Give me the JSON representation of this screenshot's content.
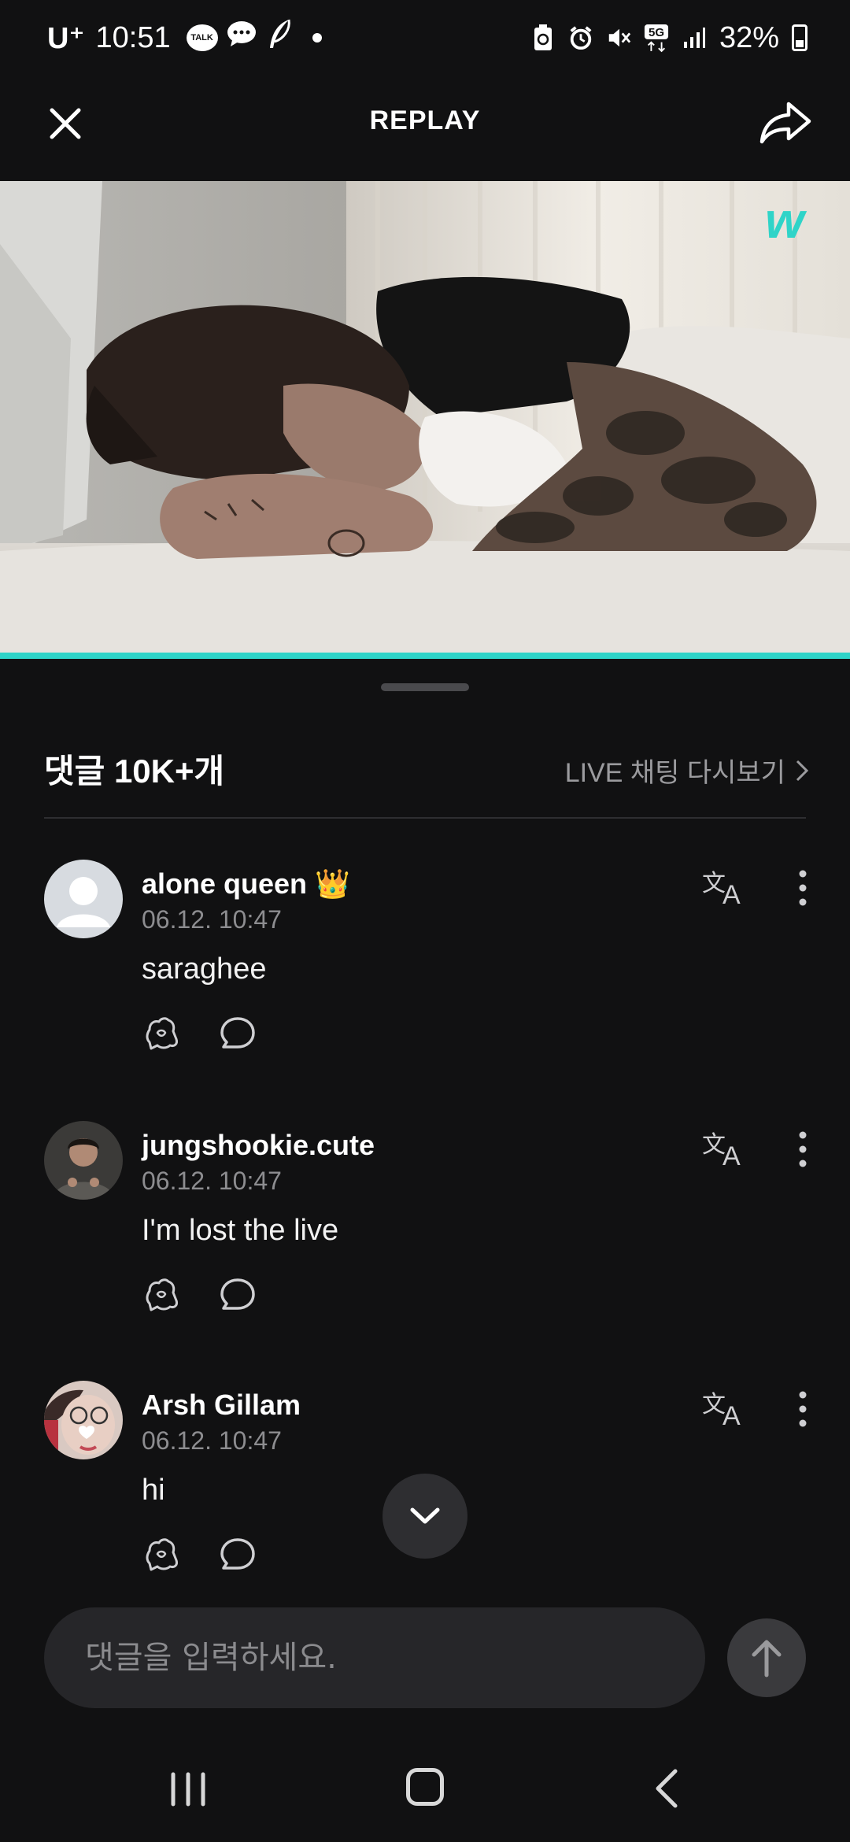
{
  "status_bar": {
    "carrier": "U⁺",
    "time": "10:51",
    "notif_talk_label": "TALK",
    "battery_pct": "32%",
    "network": "5G",
    "icons": [
      "kakaotalk-icon",
      "message-icon",
      "feather-icon",
      "dot-icon",
      "battery-saver-icon",
      "alarm-icon",
      "mute-icon",
      "5g-icon",
      "signal-icon",
      "battery-icon"
    ]
  },
  "header": {
    "title": "REPLAY",
    "close_icon": "close-icon",
    "share_icon": "share-icon"
  },
  "video": {
    "watermark": "w",
    "progress": 1.0,
    "accent_color": "#2fd4c8"
  },
  "comments": {
    "title": "댓글 10K+개",
    "live_chat_link": "LIVE 채팅 다시보기",
    "items": [
      {
        "username": "alone queen",
        "badge": "👑",
        "timestamp": "06.12. 10:47",
        "text": "saraghee"
      },
      {
        "username": "jungshookie.cute",
        "badge": "",
        "timestamp": "06.12. 10:47",
        "text": "I'm lost the live"
      },
      {
        "username": "Arsh Gillam",
        "badge": "",
        "timestamp": "06.12. 10:47",
        "text": "hi"
      }
    ]
  },
  "input": {
    "placeholder": "댓글을 입력하세요.",
    "value": ""
  }
}
